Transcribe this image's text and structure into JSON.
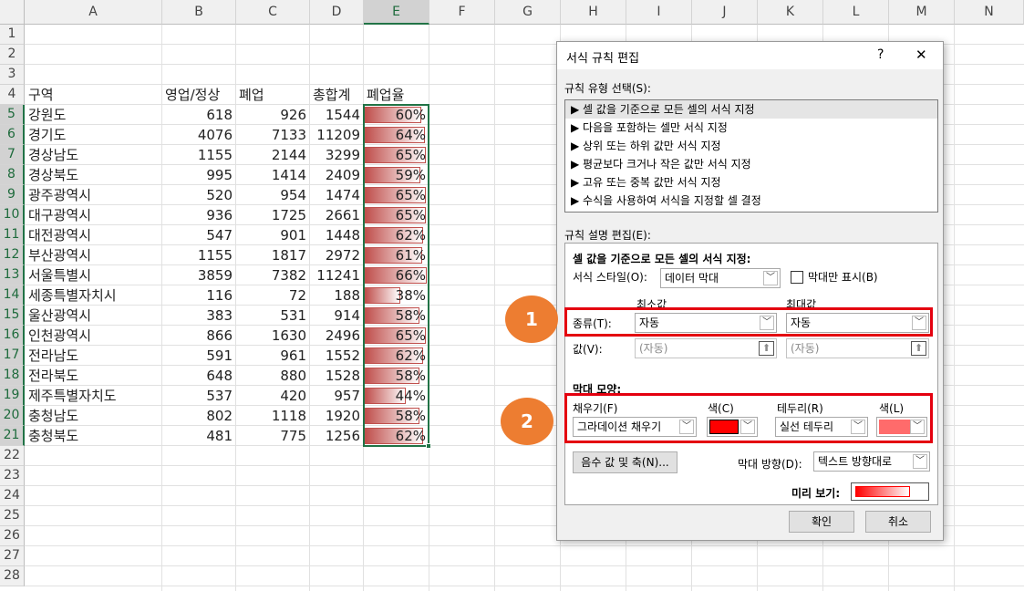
{
  "sheet": {
    "columns": [
      "A",
      "B",
      "C",
      "D",
      "E",
      "F",
      "G",
      "H",
      "I",
      "J",
      "K",
      "L",
      "M",
      "N"
    ],
    "row_numbers": [
      "1",
      "2",
      "3",
      "4",
      "5",
      "6",
      "7",
      "8",
      "9",
      "10",
      "11",
      "12",
      "13",
      "14",
      "15",
      "16",
      "17",
      "18",
      "19",
      "20",
      "21",
      "22",
      "23",
      "24",
      "25",
      "26",
      "27",
      "28"
    ],
    "headers": {
      "a": "구역",
      "b": "영업/정상",
      "c": "폐업",
      "d": "총합계",
      "e": "폐업율"
    },
    "rows": [
      {
        "region": "강원도",
        "open": "618",
        "closed": "926",
        "total": "1544",
        "rate": "60%",
        "rate_value": 0.6
      },
      {
        "region": "경기도",
        "open": "4076",
        "closed": "7133",
        "total": "11209",
        "rate": "64%",
        "rate_value": 0.64
      },
      {
        "region": "경상남도",
        "open": "1155",
        "closed": "2144",
        "total": "3299",
        "rate": "65%",
        "rate_value": 0.65
      },
      {
        "region": "경상북도",
        "open": "995",
        "closed": "1414",
        "total": "2409",
        "rate": "59%",
        "rate_value": 0.59
      },
      {
        "region": "광주광역시",
        "open": "520",
        "closed": "954",
        "total": "1474",
        "rate": "65%",
        "rate_value": 0.65
      },
      {
        "region": "대구광역시",
        "open": "936",
        "closed": "1725",
        "total": "2661",
        "rate": "65%",
        "rate_value": 0.65
      },
      {
        "region": "대전광역시",
        "open": "547",
        "closed": "901",
        "total": "1448",
        "rate": "62%",
        "rate_value": 0.62
      },
      {
        "region": "부산광역시",
        "open": "1155",
        "closed": "1817",
        "total": "2972",
        "rate": "61%",
        "rate_value": 0.61
      },
      {
        "region": "서울특별시",
        "open": "3859",
        "closed": "7382",
        "total": "11241",
        "rate": "66%",
        "rate_value": 0.66
      },
      {
        "region": "세종특별자치시",
        "open": "116",
        "closed": "72",
        "total": "188",
        "rate": "38%",
        "rate_value": 0.38
      },
      {
        "region": "울산광역시",
        "open": "383",
        "closed": "531",
        "total": "914",
        "rate": "58%",
        "rate_value": 0.58
      },
      {
        "region": "인천광역시",
        "open": "866",
        "closed": "1630",
        "total": "2496",
        "rate": "65%",
        "rate_value": 0.65
      },
      {
        "region": "전라남도",
        "open": "591",
        "closed": "961",
        "total": "1552",
        "rate": "62%",
        "rate_value": 0.62
      },
      {
        "region": "전라북도",
        "open": "648",
        "closed": "880",
        "total": "1528",
        "rate": "58%",
        "rate_value": 0.58
      },
      {
        "region": "제주특별자치도",
        "open": "537",
        "closed": "420",
        "total": "957",
        "rate": "44%",
        "rate_value": 0.44
      },
      {
        "region": "충청남도",
        "open": "802",
        "closed": "1118",
        "total": "1920",
        "rate": "58%",
        "rate_value": 0.58
      },
      {
        "region": "충청북도",
        "open": "481",
        "closed": "775",
        "total": "1256",
        "rate": "62%",
        "rate_value": 0.62
      }
    ],
    "bar_color": "#c0504d"
  },
  "dialog": {
    "title": "서식 규칙 편집",
    "help": "?",
    "close": "✕",
    "rule_type_label": "규칙 유형 선택(S):",
    "rule_types": [
      "▶ 셀 값을 기준으로 모든 셀의 서식 지정",
      "▶ 다음을 포함하는 셀만 서식 지정",
      "▶ 상위 또는 하위 값만 서식 지정",
      "▶ 평균보다 크거나 작은 값만 서식 지정",
      "▶ 고유 또는 중복 값만 서식 지정",
      "▶ 수식을 사용하여 서식을 지정할 셀 결정"
    ],
    "desc_label": "규칙 설명 편집(E):",
    "desc_heading": "셀 값을 기준으로 모든 셀의 서식 지정:",
    "format_style_label": "서식 스타일(O):",
    "format_style_value": "데이터 막대",
    "bar_only_label": "막대만 표시(B)",
    "min_label": "최소값",
    "max_label": "최대값",
    "type_label": "종류(T):",
    "min_type": "자동",
    "max_type": "자동",
    "value_label": "값(V):",
    "min_value_placeholder": "(자동)",
    "max_value_placeholder": "(자동)",
    "bar_appearance_label": "막대 모양:",
    "fill_label": "채우기(F)",
    "fill_value": "그라데이션 채우기",
    "fill_color_label": "색(C)",
    "fill_color": "#ff0000",
    "border_label": "테두리(R)",
    "border_value": "실선 테두리",
    "border_color_label": "색(L)",
    "border_color": "#ff6b6b",
    "negative_button": "음수 값 및 축(N)...",
    "direction_label": "막대 방향(D):",
    "direction_value": "텍스트 방향대로",
    "preview_label": "미리 보기:",
    "ok_button": "확인",
    "cancel_button": "취소"
  },
  "annotations": {
    "badge1": "1",
    "badge2": "2",
    "badge_color": "#ed7d31",
    "box_color": "#e4000f"
  }
}
